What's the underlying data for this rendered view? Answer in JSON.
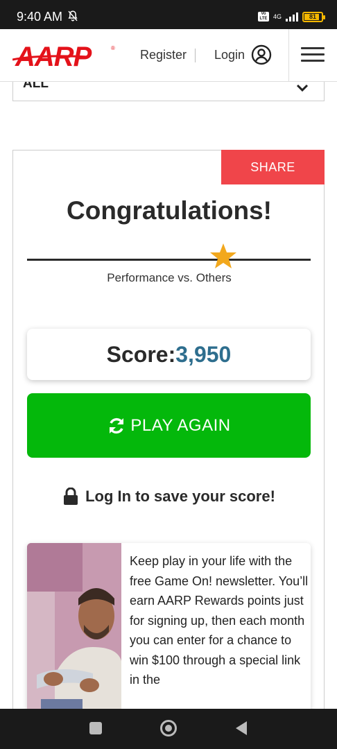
{
  "status_bar": {
    "time": "9:40 AM",
    "network": "4G",
    "volte": "Vo LTE",
    "battery": "81",
    "battery_color": "#f5b800"
  },
  "header": {
    "logo": "AARP",
    "logo_color": "#e4121a",
    "register_label": "Register",
    "login_label": "Login",
    "icons": [
      "user-circle-icon",
      "hamburger-menu-icon"
    ]
  },
  "filter": {
    "selected": "ALL"
  },
  "results": {
    "share_label": "SHARE",
    "share_color": "#f0454a",
    "title": "Congratulations!",
    "performance_label": "Performance vs. Others",
    "performance_position": 0.69,
    "score_label": "Score:",
    "score_value": "3,950",
    "score_color": "#2e6e8e",
    "play_again_label": "PLAY AGAIN",
    "play_again_color": "#04b80b",
    "save_prompt": "Log In to save your score!"
  },
  "promo": {
    "text": "Keep play in your life with the free Game On! newsletter. You’ll earn AARP Rewards points just for signing up, then each month you can enter for a chance to win $100 through a special link in the"
  },
  "nav_bar": {
    "icons": [
      "recents-square-icon",
      "home-circle-icon",
      "back-triangle-icon"
    ]
  }
}
